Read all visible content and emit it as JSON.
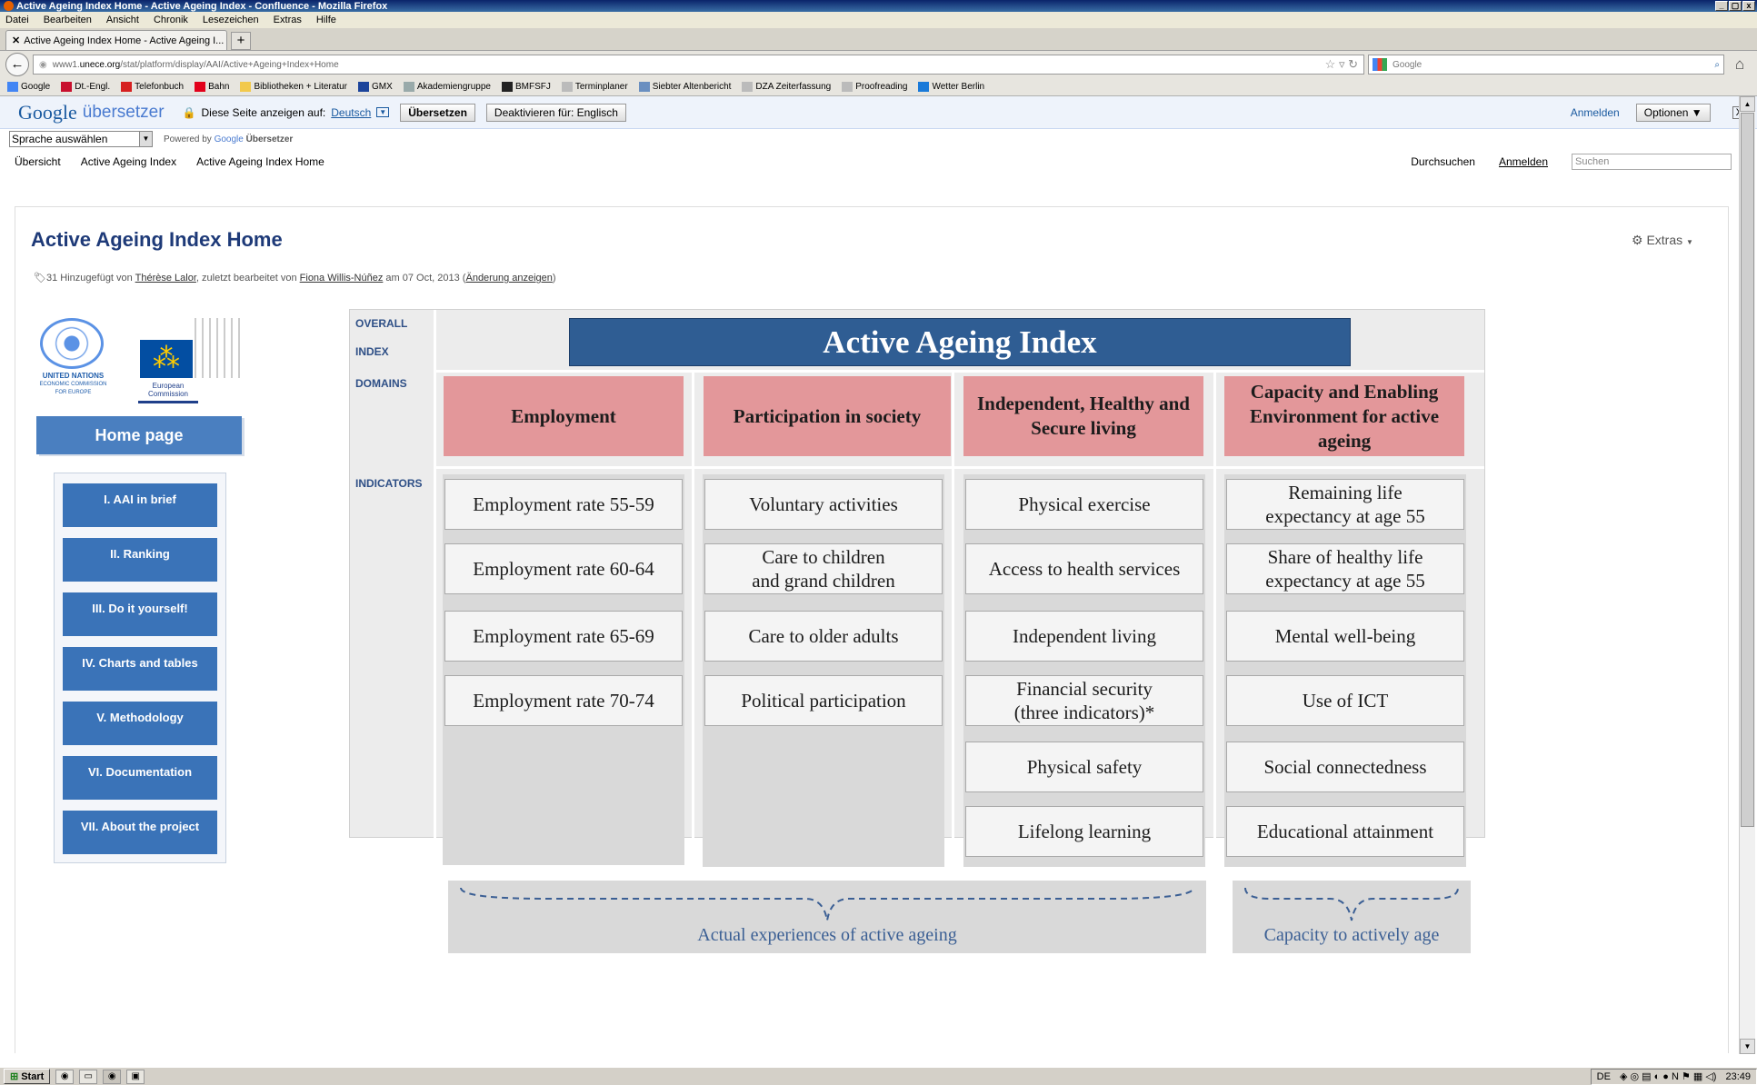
{
  "window": {
    "title": "Active Ageing Index Home - Active Ageing Index - Confluence - Mozilla Firefox",
    "controls": [
      "_",
      "▢",
      "x"
    ]
  },
  "menubar": [
    "Datei",
    "Bearbeiten",
    "Ansicht",
    "Chronik",
    "Lesezeichen",
    "Extras",
    "Hilfe"
  ],
  "tab": {
    "label": "Active Ageing Index Home - Active Ageing I...",
    "new": "+"
  },
  "nav": {
    "url_pre": "www1.",
    "url_host": "unece.org",
    "url_rest": "/stat/platform/display/AAI/Active+Ageing+Index+Home",
    "search_placeholder": "Google"
  },
  "bookmarks": [
    {
      "label": "Google",
      "color": "#4285f4"
    },
    {
      "label": "Dt.-Engl.",
      "color": "#c8102e"
    },
    {
      "label": "Telefonbuch",
      "color": "#d62020"
    },
    {
      "label": "Bahn",
      "color": "#e2001a"
    },
    {
      "label": "Bibliotheken + Literatur",
      "color": "#f2c94c"
    },
    {
      "label": "GMX",
      "color": "#1c449b"
    },
    {
      "label": "Akademiengruppe",
      "color": "#9aa"
    },
    {
      "label": "BMFSFJ",
      "color": "#222"
    },
    {
      "label": "Terminplaner",
      "color": "#bbb"
    },
    {
      "label": "Siebter Altenbericht",
      "color": "#6a8fc0"
    },
    {
      "label": "DZA Zeiterfassung",
      "color": "#bbb"
    },
    {
      "label": "Proofreading",
      "color": "#bbb"
    },
    {
      "label": "Wetter Berlin",
      "color": "#1a7ad9"
    }
  ],
  "translate": {
    "logo_google": "Google",
    "logo_sub": "übersetzer",
    "prompt": "Diese Seite anzeigen auf:",
    "language": "Deutsch",
    "translate_btn": "Übersetzen",
    "deactivate_btn": "Deaktivieren für: Englisch",
    "signin": "Anmelden",
    "options": "Optionen ▼",
    "close": "X",
    "select_language": "Sprache auswählen",
    "powered": "Powered by",
    "powered_google": "Google",
    "powered_translate": "Übersetzer"
  },
  "confnav": {
    "items": [
      "Übersicht",
      "Active Ageing Index",
      "Active Ageing Index Home"
    ],
    "browse": "Durchsuchen",
    "login": "Anmelden",
    "search_placeholder": "Suchen"
  },
  "page": {
    "title": "Active Ageing Index Home",
    "extras": "Extras",
    "meta_count": "31",
    "meta_added": "Hinzugefügt von",
    "meta_author": "Thérèse Lalor",
    "meta_edited": ", zuletzt bearbeitet von",
    "meta_editor": "Fiona Willis-Núñez",
    "meta_date": "am 07 Oct, 2013",
    "meta_changes": "Änderung anzeigen"
  },
  "logos": {
    "un": "UNITED NATIONS",
    "un_sub": "ECONOMIC COMMISSION FOR EUROPE",
    "eu": "European Commission"
  },
  "sidebar": {
    "home": "Home page",
    "items": [
      "I. AAI in brief",
      "II. Ranking",
      "III. Do it yourself!",
      "IV. Charts and tables",
      "V. Methodology",
      "VI. Documentation",
      "VII. About the project"
    ]
  },
  "diagram": {
    "labels": {
      "overall": "OVERALL",
      "index": "INDEX",
      "domains": "DOMAINS",
      "indicators": "INDICATORS"
    },
    "title": "Active Ageing Index",
    "domains": [
      "Employment",
      "Participation in society",
      "Independent, Healthy and Secure living",
      "Capacity and Enabling Environment for active ageing"
    ],
    "indicators": [
      [
        "Employment rate 55-59",
        "Employment rate 60-64",
        "Employment rate 65-69",
        "Employment rate 70-74"
      ],
      [
        "Voluntary activities",
        "Care to children\nand grand children",
        "Care to older adults",
        "Political participation"
      ],
      [
        "Physical exercise",
        "Access to health services",
        "Independent living",
        "Financial security\n(three indicators)*",
        "Physical safety",
        "Lifelong learning"
      ],
      [
        "Remaining life\nexpectancy at age 55",
        "Share of healthy life\nexpectancy at age 55",
        "Mental well-being",
        "Use of ICT",
        "Social connectedness",
        "Educational attainment"
      ]
    ],
    "braces": [
      "Actual experiences of active ageing",
      "Capacity to actively age"
    ],
    "colors": {
      "title_bg": "#2f5d93",
      "domain_bg": "#e3979a",
      "label_text": "#2e4f86"
    }
  },
  "taskbar": {
    "start": "Start",
    "lang": "DE",
    "time": "23:49"
  }
}
